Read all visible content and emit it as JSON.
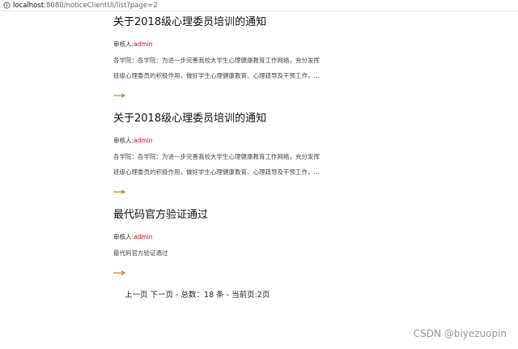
{
  "browser": {
    "url_host": "localhost",
    "url_rest": ":8080/noticeClientUI/list?page=2"
  },
  "notices": [
    {
      "title": "关于2018级心理委员培训的通知",
      "reviewer_label": "审核人:",
      "reviewer_name": "admin",
      "summary_line1": "各学院：各学院：为进一步完善我校大学生心理健康教育工作网络，充分发挥",
      "summary_line2": "班级心理委员的积极作用，做好学生心理健康教育、心理疏导及干预工作，..."
    },
    {
      "title": "关于2018级心理委员培训的通知",
      "reviewer_label": "审核人:",
      "reviewer_name": "admin",
      "summary_line1": "各学院：各学院：为进一步完善我校大学生心理健康教育工作网络，充分发挥",
      "summary_line2": "班级心理委员的积极作用，做好学生心理健康教育、心理疏导及干预工作，..."
    },
    {
      "title": "最代码官方验证通过",
      "reviewer_label": "审核人:",
      "reviewer_name": "admin",
      "summary_line1": "最代码官方验证通过",
      "summary_line2": ""
    }
  ],
  "pager": {
    "prev": "上一页",
    "next": "下一页",
    "total_text": " - 总数：18 条 - 当前页:2页"
  },
  "watermark": "CSDN @biyezuopin",
  "colors": {
    "accent_arrow": "#e07b1c",
    "reviewer_name": "#d40000"
  }
}
